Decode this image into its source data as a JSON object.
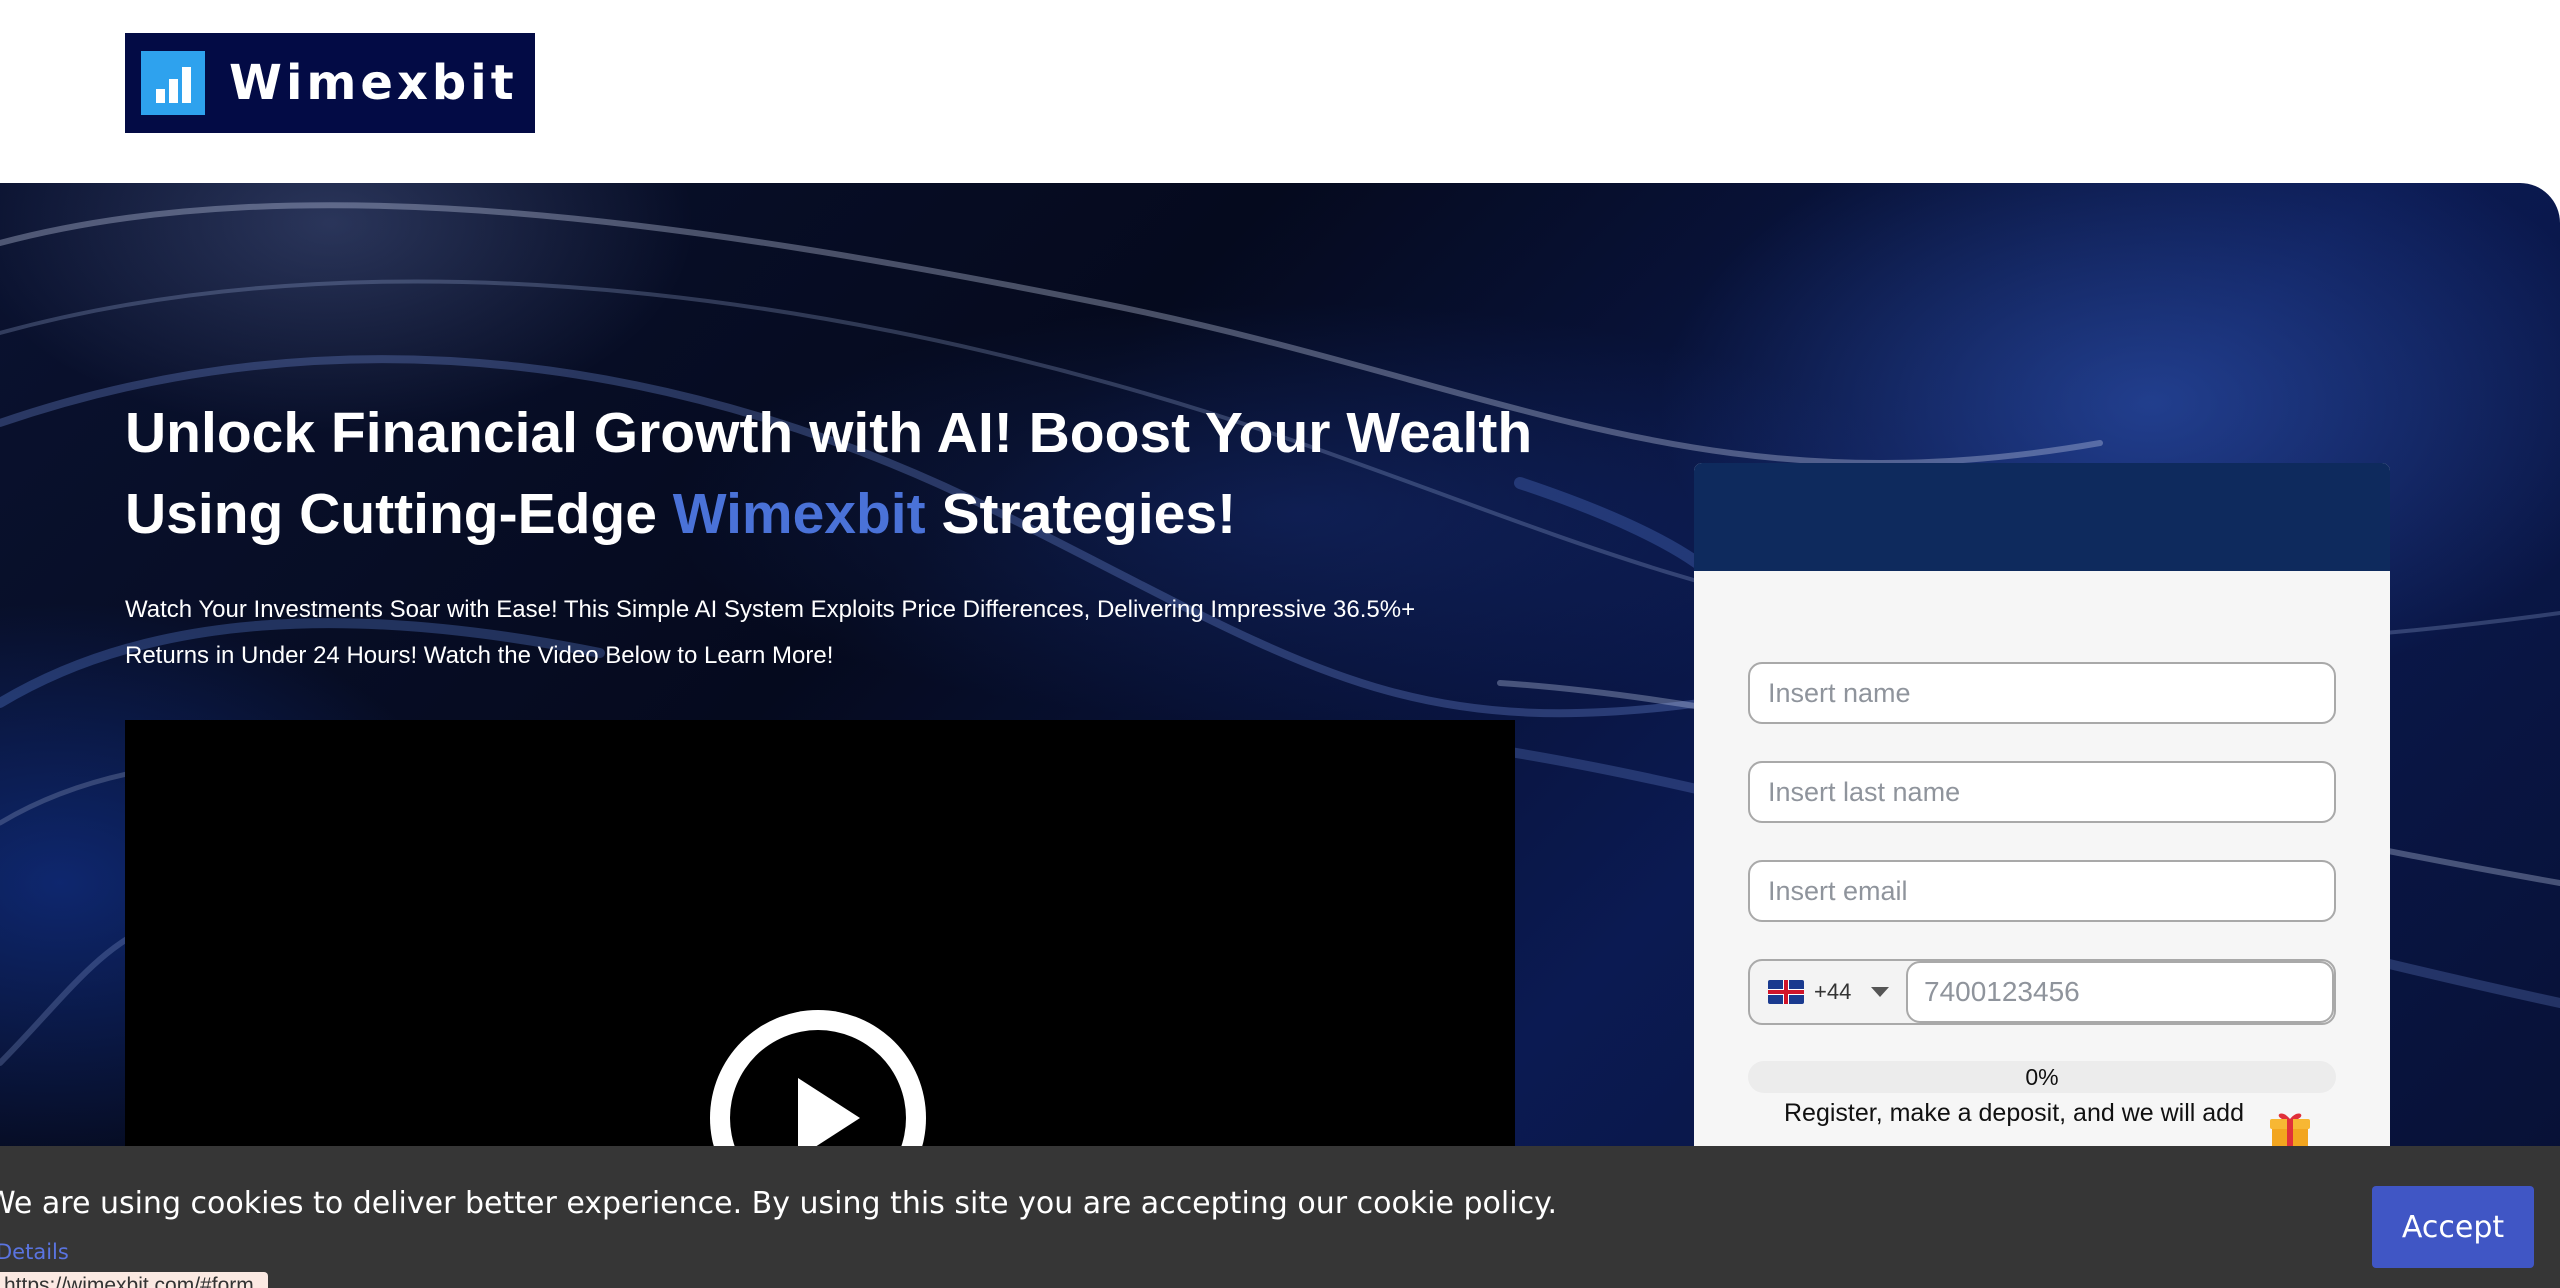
{
  "header": {
    "logo_text": "Wimexbit"
  },
  "hero": {
    "title_part1": "Unlock Financial Growth with AI! Boost Your Wealth Using Cutting-Edge ",
    "title_accent": "Wimexbit",
    "title_part2": " Strategies!",
    "subtitle": "Watch Your Investments Soar with Ease! This Simple AI System Exploits Price Differences, Delivering Impressive 36.5%+ Returns in Under 24 Hours! Watch the Video Below to Learn More!"
  },
  "form": {
    "name_placeholder": "Insert name",
    "last_name_placeholder": "Insert last name",
    "email_placeholder": "Insert email",
    "country_code": "+44",
    "phone_placeholder": "7400123456",
    "progress_label": "0%",
    "promo_text": "Register, make a deposit, and we will add"
  },
  "cookie": {
    "message": "We are using cookies to deliver better experience. By using this site you are accepting our cookie policy.",
    "details_link": "Details",
    "accept_label": "Accept"
  },
  "status_bar": {
    "url": "https://wimexbit.com/#form"
  },
  "colors": {
    "accent": "#4a72d8",
    "form_header": "#0e2a5d",
    "accept_button": "#4056c5",
    "cookie_bar": "#363636"
  }
}
